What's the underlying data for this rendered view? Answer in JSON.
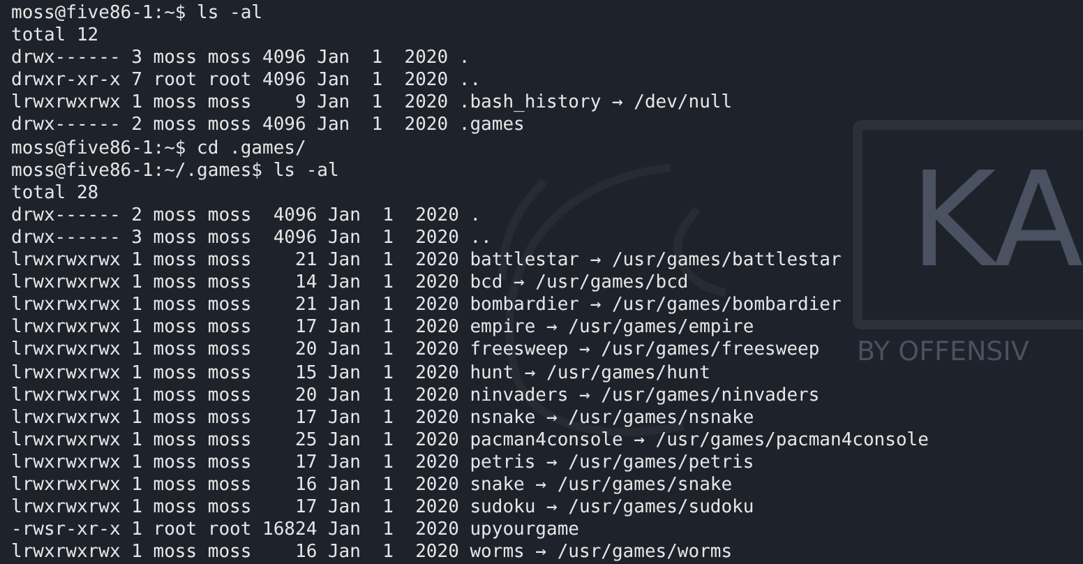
{
  "wallpaper": {
    "logo_text": "KA",
    "tagline": "BY OFFENSIV"
  },
  "terminal": {
    "lines": [
      "moss@five86-1:~$ ls -al",
      "total 12",
      "drwx------ 3 moss moss 4096 Jan  1  2020 .",
      "drwxr-xr-x 7 root root 4096 Jan  1  2020 ..",
      "lrwxrwxrwx 1 moss moss    9 Jan  1  2020 .bash_history → /dev/null",
      "drwx------ 2 moss moss 4096 Jan  1  2020 .games",
      "moss@five86-1:~$ cd .games/",
      "moss@five86-1:~/.games$ ls -al",
      "total 28",
      "drwx------ 2 moss moss  4096 Jan  1  2020 .",
      "drwx------ 3 moss moss  4096 Jan  1  2020 ..",
      "lrwxrwxrwx 1 moss moss    21 Jan  1  2020 battlestar → /usr/games/battlestar",
      "lrwxrwxrwx 1 moss moss    14 Jan  1  2020 bcd → /usr/games/bcd",
      "lrwxrwxrwx 1 moss moss    21 Jan  1  2020 bombardier → /usr/games/bombardier",
      "lrwxrwxrwx 1 moss moss    17 Jan  1  2020 empire → /usr/games/empire",
      "lrwxrwxrwx 1 moss moss    20 Jan  1  2020 freesweep → /usr/games/freesweep",
      "lrwxrwxrwx 1 moss moss    15 Jan  1  2020 hunt → /usr/games/hunt",
      "lrwxrwxrwx 1 moss moss    20 Jan  1  2020 ninvaders → /usr/games/ninvaders",
      "lrwxrwxrwx 1 moss moss    17 Jan  1  2020 nsnake → /usr/games/nsnake",
      "lrwxrwxrwx 1 moss moss    25 Jan  1  2020 pacman4console → /usr/games/pacman4console",
      "lrwxrwxrwx 1 moss moss    17 Jan  1  2020 petris → /usr/games/petris",
      "lrwxrwxrwx 1 moss moss    16 Jan  1  2020 snake → /usr/games/snake",
      "lrwxrwxrwx 1 moss moss    17 Jan  1  2020 sudoku → /usr/games/sudoku",
      "-rwsr-xr-x 1 root root 16824 Jan  1  2020 upyourgame",
      "lrwxrwxrwx 1 moss moss    16 Jan  1  2020 worms → /usr/games/worms"
    ]
  }
}
